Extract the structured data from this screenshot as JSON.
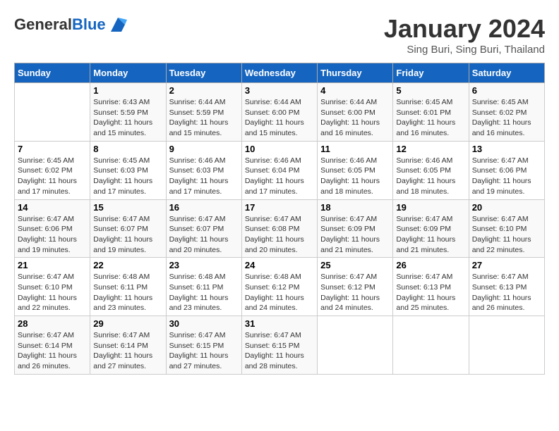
{
  "header": {
    "logo_general": "General",
    "logo_blue": "Blue",
    "month_title": "January 2024",
    "location": "Sing Buri, Sing Buri, Thailand"
  },
  "weekdays": [
    "Sunday",
    "Monday",
    "Tuesday",
    "Wednesday",
    "Thursday",
    "Friday",
    "Saturday"
  ],
  "weeks": [
    [
      {
        "day": "",
        "sunrise": "",
        "sunset": "",
        "daylight": ""
      },
      {
        "day": "1",
        "sunrise": "Sunrise: 6:43 AM",
        "sunset": "Sunset: 5:59 PM",
        "daylight": "Daylight: 11 hours and 15 minutes."
      },
      {
        "day": "2",
        "sunrise": "Sunrise: 6:44 AM",
        "sunset": "Sunset: 5:59 PM",
        "daylight": "Daylight: 11 hours and 15 minutes."
      },
      {
        "day": "3",
        "sunrise": "Sunrise: 6:44 AM",
        "sunset": "Sunset: 6:00 PM",
        "daylight": "Daylight: 11 hours and 15 minutes."
      },
      {
        "day": "4",
        "sunrise": "Sunrise: 6:44 AM",
        "sunset": "Sunset: 6:00 PM",
        "daylight": "Daylight: 11 hours and 16 minutes."
      },
      {
        "day": "5",
        "sunrise": "Sunrise: 6:45 AM",
        "sunset": "Sunset: 6:01 PM",
        "daylight": "Daylight: 11 hours and 16 minutes."
      },
      {
        "day": "6",
        "sunrise": "Sunrise: 6:45 AM",
        "sunset": "Sunset: 6:02 PM",
        "daylight": "Daylight: 11 hours and 16 minutes."
      }
    ],
    [
      {
        "day": "7",
        "sunrise": "Sunrise: 6:45 AM",
        "sunset": "Sunset: 6:02 PM",
        "daylight": "Daylight: 11 hours and 17 minutes."
      },
      {
        "day": "8",
        "sunrise": "Sunrise: 6:45 AM",
        "sunset": "Sunset: 6:03 PM",
        "daylight": "Daylight: 11 hours and 17 minutes."
      },
      {
        "day": "9",
        "sunrise": "Sunrise: 6:46 AM",
        "sunset": "Sunset: 6:03 PM",
        "daylight": "Daylight: 11 hours and 17 minutes."
      },
      {
        "day": "10",
        "sunrise": "Sunrise: 6:46 AM",
        "sunset": "Sunset: 6:04 PM",
        "daylight": "Daylight: 11 hours and 17 minutes."
      },
      {
        "day": "11",
        "sunrise": "Sunrise: 6:46 AM",
        "sunset": "Sunset: 6:05 PM",
        "daylight": "Daylight: 11 hours and 18 minutes."
      },
      {
        "day": "12",
        "sunrise": "Sunrise: 6:46 AM",
        "sunset": "Sunset: 6:05 PM",
        "daylight": "Daylight: 11 hours and 18 minutes."
      },
      {
        "day": "13",
        "sunrise": "Sunrise: 6:47 AM",
        "sunset": "Sunset: 6:06 PM",
        "daylight": "Daylight: 11 hours and 19 minutes."
      }
    ],
    [
      {
        "day": "14",
        "sunrise": "Sunrise: 6:47 AM",
        "sunset": "Sunset: 6:06 PM",
        "daylight": "Daylight: 11 hours and 19 minutes."
      },
      {
        "day": "15",
        "sunrise": "Sunrise: 6:47 AM",
        "sunset": "Sunset: 6:07 PM",
        "daylight": "Daylight: 11 hours and 19 minutes."
      },
      {
        "day": "16",
        "sunrise": "Sunrise: 6:47 AM",
        "sunset": "Sunset: 6:07 PM",
        "daylight": "Daylight: 11 hours and 20 minutes."
      },
      {
        "day": "17",
        "sunrise": "Sunrise: 6:47 AM",
        "sunset": "Sunset: 6:08 PM",
        "daylight": "Daylight: 11 hours and 20 minutes."
      },
      {
        "day": "18",
        "sunrise": "Sunrise: 6:47 AM",
        "sunset": "Sunset: 6:09 PM",
        "daylight": "Daylight: 11 hours and 21 minutes."
      },
      {
        "day": "19",
        "sunrise": "Sunrise: 6:47 AM",
        "sunset": "Sunset: 6:09 PM",
        "daylight": "Daylight: 11 hours and 21 minutes."
      },
      {
        "day": "20",
        "sunrise": "Sunrise: 6:47 AM",
        "sunset": "Sunset: 6:10 PM",
        "daylight": "Daylight: 11 hours and 22 minutes."
      }
    ],
    [
      {
        "day": "21",
        "sunrise": "Sunrise: 6:47 AM",
        "sunset": "Sunset: 6:10 PM",
        "daylight": "Daylight: 11 hours and 22 minutes."
      },
      {
        "day": "22",
        "sunrise": "Sunrise: 6:48 AM",
        "sunset": "Sunset: 6:11 PM",
        "daylight": "Daylight: 11 hours and 23 minutes."
      },
      {
        "day": "23",
        "sunrise": "Sunrise: 6:48 AM",
        "sunset": "Sunset: 6:11 PM",
        "daylight": "Daylight: 11 hours and 23 minutes."
      },
      {
        "day": "24",
        "sunrise": "Sunrise: 6:48 AM",
        "sunset": "Sunset: 6:12 PM",
        "daylight": "Daylight: 11 hours and 24 minutes."
      },
      {
        "day": "25",
        "sunrise": "Sunrise: 6:47 AM",
        "sunset": "Sunset: 6:12 PM",
        "daylight": "Daylight: 11 hours and 24 minutes."
      },
      {
        "day": "26",
        "sunrise": "Sunrise: 6:47 AM",
        "sunset": "Sunset: 6:13 PM",
        "daylight": "Daylight: 11 hours and 25 minutes."
      },
      {
        "day": "27",
        "sunrise": "Sunrise: 6:47 AM",
        "sunset": "Sunset: 6:13 PM",
        "daylight": "Daylight: 11 hours and 26 minutes."
      }
    ],
    [
      {
        "day": "28",
        "sunrise": "Sunrise: 6:47 AM",
        "sunset": "Sunset: 6:14 PM",
        "daylight": "Daylight: 11 hours and 26 minutes."
      },
      {
        "day": "29",
        "sunrise": "Sunrise: 6:47 AM",
        "sunset": "Sunset: 6:14 PM",
        "daylight": "Daylight: 11 hours and 27 minutes."
      },
      {
        "day": "30",
        "sunrise": "Sunrise: 6:47 AM",
        "sunset": "Sunset: 6:15 PM",
        "daylight": "Daylight: 11 hours and 27 minutes."
      },
      {
        "day": "31",
        "sunrise": "Sunrise: 6:47 AM",
        "sunset": "Sunset: 6:15 PM",
        "daylight": "Daylight: 11 hours and 28 minutes."
      },
      {
        "day": "",
        "sunrise": "",
        "sunset": "",
        "daylight": ""
      },
      {
        "day": "",
        "sunrise": "",
        "sunset": "",
        "daylight": ""
      },
      {
        "day": "",
        "sunrise": "",
        "sunset": "",
        "daylight": ""
      }
    ]
  ]
}
